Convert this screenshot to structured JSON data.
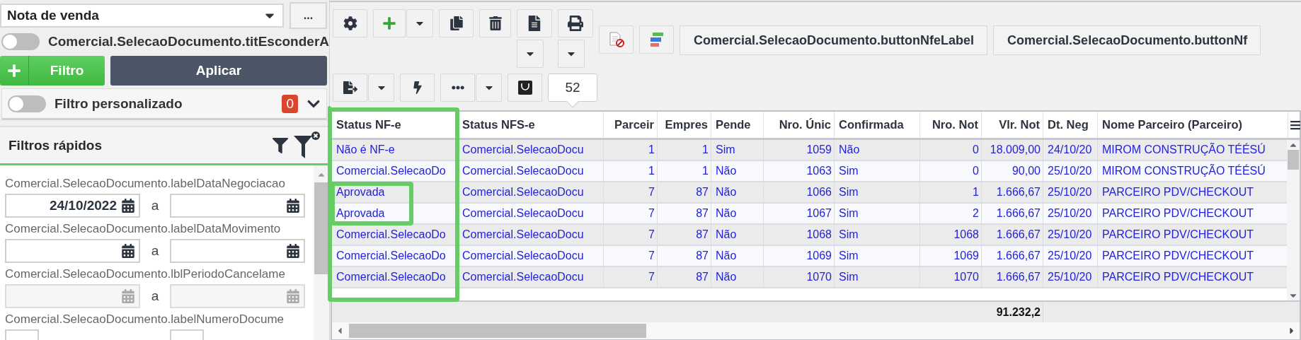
{
  "document_type": {
    "value": "Nota de venda"
  },
  "more_button": "...",
  "hide_toggle": {
    "label": "Comercial.SelecaoDocumento.titEsconderA",
    "on": false
  },
  "filter_button": {
    "label": "Filtro"
  },
  "apply_button": {
    "label": "Aplicar"
  },
  "custom_filter": {
    "label": "Filtro personalizado",
    "on": false,
    "count": "0",
    "expanded": false
  },
  "quick_filters": {
    "title": "Filtros rápidos",
    "fields": [
      {
        "label": "Comercial.SelecaoDocumento.labelDataNegociacao",
        "from": "24/10/2022",
        "separator": "a",
        "disabled": false
      },
      {
        "label": "Comercial.SelecaoDocumento.labelDataMovimento",
        "separator": "a",
        "disabled": false
      },
      {
        "label": "Comercial.SelecaoDocumento.lblPeriodoCancelame",
        "separator": "a",
        "disabled": true
      },
      {
        "label": "Comercial.SelecaoDocumento.labelNumeroDocume",
        "disabled": false
      }
    ]
  },
  "toolbar": {
    "text_buttons": [
      {
        "label": "Comercial.SelecaoDocumento.buttonNfeLabel"
      },
      {
        "label": "Comercial.SelecaoDocumento.buttonNf"
      }
    ],
    "count_badge": "52"
  },
  "table": {
    "columns": [
      {
        "label": "Status NF-e"
      },
      {
        "label": "Status NFS-e"
      },
      {
        "label": "Parceir"
      },
      {
        "label": "Empres"
      },
      {
        "label": "Pende"
      },
      {
        "label": "Nro. Únic"
      },
      {
        "label": "Confirmada"
      },
      {
        "label": "Nro. Not"
      },
      {
        "label": "Vlr. Not",
        "total": "91.232,2"
      },
      {
        "label": "Dt. Neg"
      },
      {
        "label": "Nome Parceiro (Parceiro)"
      }
    ],
    "rows": [
      [
        "Não é NF-e",
        "Comercial.SelecaoDocu",
        "1",
        "1",
        "Sim",
        "1059",
        "Não",
        "0",
        "18.009,00",
        "24/10/20",
        "MIROM CONSTRUÇÃO TÉÉSÚ"
      ],
      [
        "Comercial.SelecaoDo",
        "Comercial.SelecaoDocu",
        "1",
        "1",
        "Não",
        "1063",
        "Sim",
        "0",
        "90,00",
        "25/10/20",
        "MIROM CONSTRUÇÃO TÉÉSÚ"
      ],
      [
        "Aprovada",
        "Comercial.SelecaoDocu",
        "7",
        "87",
        "Não",
        "1066",
        "Sim",
        "1",
        "1.666,67",
        "25/10/20",
        "PARCEIRO PDV/CHECKOUT"
      ],
      [
        "Aprovada",
        "Comercial.SelecaoDocu",
        "7",
        "87",
        "Não",
        "1067",
        "Sim",
        "2",
        "1.666,67",
        "25/10/20",
        "PARCEIRO PDV/CHECKOUT"
      ],
      [
        "Comercial.SelecaoDo",
        "Comercial.SelecaoDocu",
        "7",
        "87",
        "Não",
        "1068",
        "Sim",
        "1068",
        "1.666,67",
        "25/10/20",
        "PARCEIRO PDV/CHECKOUT"
      ],
      [
        "Comercial.SelecaoDo",
        "Comercial.SelecaoDocu",
        "7",
        "87",
        "Não",
        "1069",
        "Sim",
        "1069",
        "1.666,67",
        "25/10/20",
        "PARCEIRO PDV/CHECKOUT"
      ],
      [
        "Comercial.SelecaoDo",
        "Comercial.SelecaoDocu",
        "7",
        "87",
        "Não",
        "1070",
        "Sim",
        "1070",
        "1.666,67",
        "25/10/20",
        "PARCEIRO PDV/CHECKOUT"
      ]
    ]
  }
}
